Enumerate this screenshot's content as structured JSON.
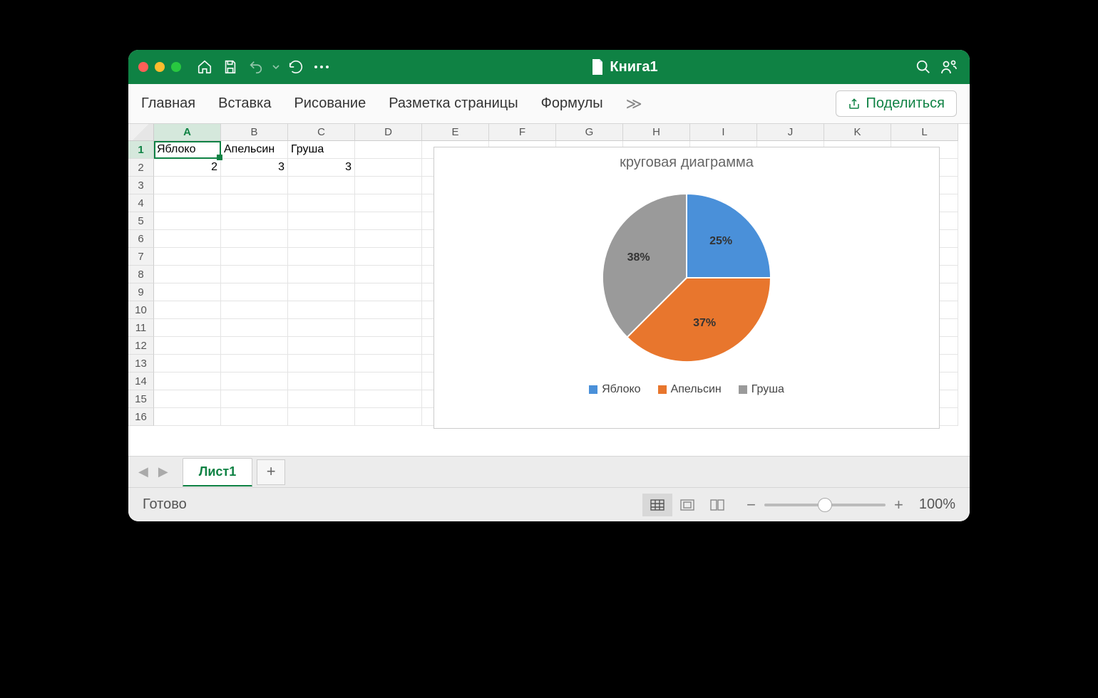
{
  "titlebar": {
    "doc_title": "Книга1"
  },
  "ribbon": {
    "tabs": [
      "Главная",
      "Вставка",
      "Рисование",
      "Разметка страницы",
      "Формулы"
    ],
    "share": "Поделиться"
  },
  "columns": [
    "A",
    "B",
    "C",
    "D",
    "E",
    "F",
    "G",
    "H",
    "I",
    "J",
    "K",
    "L"
  ],
  "row_count": 16,
  "active_cell": {
    "col": 0,
    "row": 0
  },
  "data": {
    "r1": [
      "Яблоко",
      "Апельсин",
      "Груша"
    ],
    "r2": [
      "2",
      "3",
      "3"
    ]
  },
  "chart_data": {
    "type": "pie",
    "title": "круговая диаграмма",
    "categories": [
      "Яблоко",
      "Апельсин",
      "Груша"
    ],
    "values": [
      2,
      3,
      3
    ],
    "percent_labels": [
      "25%",
      "37%",
      "38%"
    ],
    "colors": [
      "#4a90d9",
      "#e8762d",
      "#9a9a9a"
    ]
  },
  "sheet": {
    "active": "Лист1"
  },
  "status": {
    "ready": "Готово",
    "zoom": "100%"
  }
}
